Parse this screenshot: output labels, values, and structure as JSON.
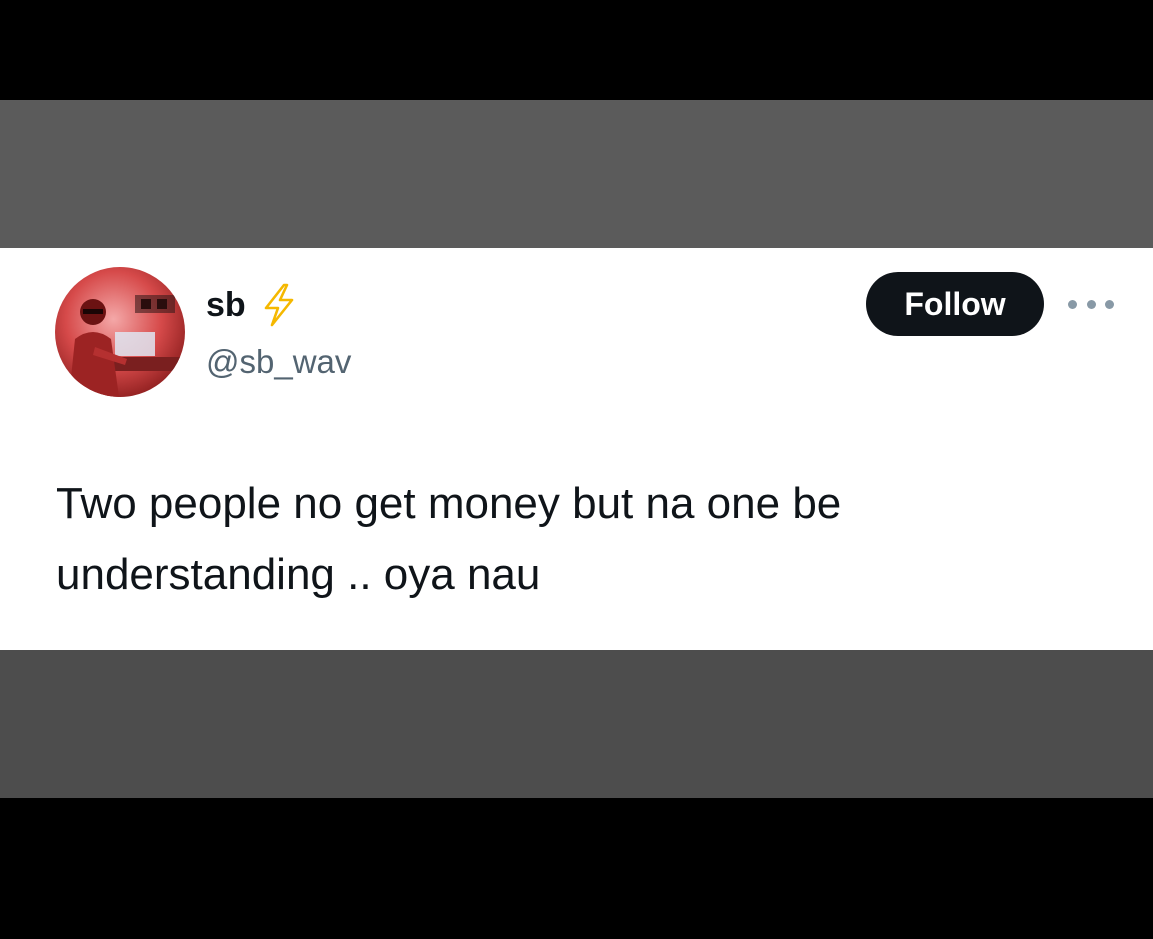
{
  "tweet": {
    "user": {
      "display_name": "sb",
      "verified_icon": "lightning-bolt-icon",
      "handle": "@sb_wav",
      "avatar": "avatar-photo"
    },
    "follow_label": "Follow",
    "more_icon": "more-options-icon",
    "text_line1": "Two people no get money but na one be",
    "text_line2": "understanding .. oya nau"
  },
  "colors": {
    "background": "#000000",
    "band_gray": "#5b5b5b",
    "card": "#ffffff",
    "text": "#0f1419",
    "handle": "#536471",
    "follow_bg": "#0f1419",
    "bolt": "#f5b800"
  }
}
